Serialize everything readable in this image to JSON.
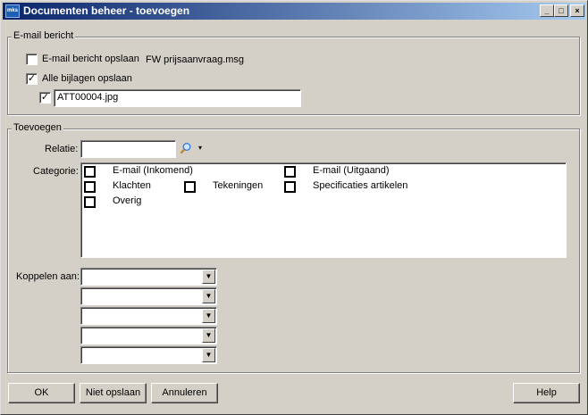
{
  "window": {
    "icon_text": "mks",
    "title": "Documenten beheer - toevoegen",
    "minimize_glyph": "_",
    "maximize_glyph": "□",
    "close_glyph": "×"
  },
  "email_group": {
    "legend": "E-mail bericht",
    "save_email": {
      "label": "E-mail bericht opslaan",
      "checked": false,
      "filename": "FW prijsaanvraag.msg"
    },
    "save_attachments": {
      "label": "Alle bijlagen opslaan",
      "checked": true
    },
    "attachment": {
      "checked": true,
      "filename": "ATT00004.jpg"
    }
  },
  "add_group": {
    "legend": "Toevoegen",
    "relatie_label": "Relatie:",
    "relatie_value": "",
    "search_icon": "magnifier-icon",
    "dropdown_glyph": "▾",
    "categorie_label": "Categorie:",
    "categories": [
      {
        "label": "E-mail (Inkomend)",
        "checked": false
      },
      {
        "label": "E-mail (Uitgaand)",
        "checked": false
      },
      {
        "label": "Klachten",
        "checked": false
      },
      {
        "label": "Tekeningen",
        "checked": false
      },
      {
        "label": "Specificaties artikelen",
        "checked": false
      },
      {
        "label": "Overig",
        "checked": false
      }
    ],
    "koppelen_label": "Koppelen aan:",
    "koppelen_values": [
      "",
      "",
      "",
      "",
      ""
    ],
    "combo_arrow_glyph": "▼"
  },
  "buttons": {
    "ok": "OK",
    "niet_opslaan": "Niet opslaan",
    "annuleren": "Annuleren",
    "help": "Help"
  }
}
